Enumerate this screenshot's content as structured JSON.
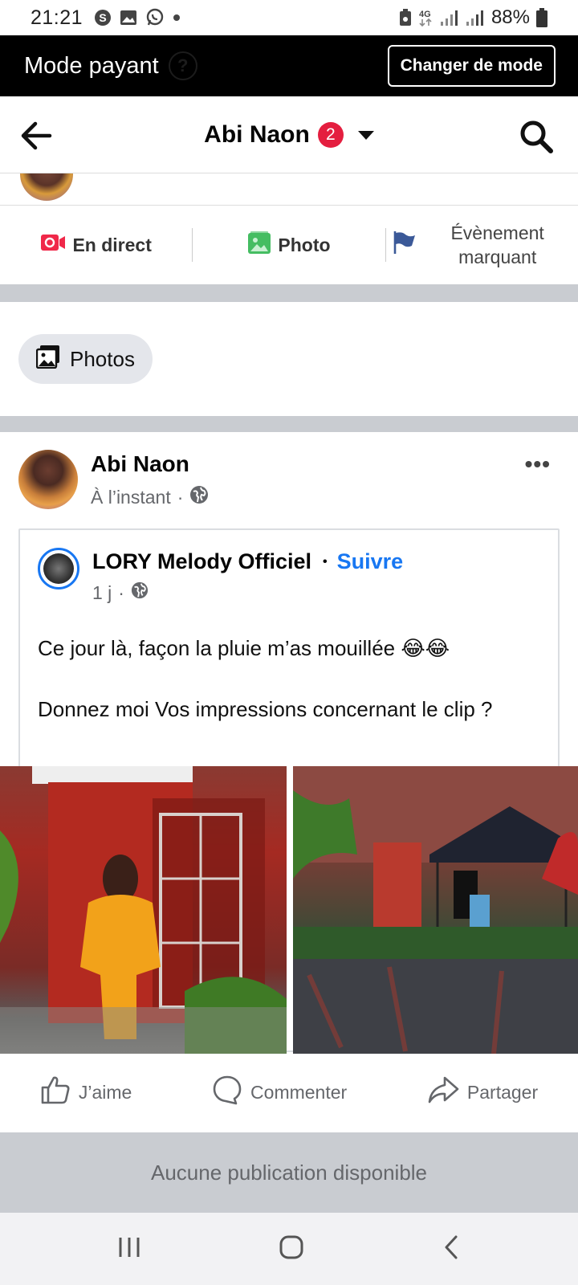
{
  "status_bar": {
    "time": "21:21",
    "network": "4G",
    "battery": "88%",
    "left_icons": [
      "skype-icon",
      "gallery-icon",
      "whatsapp-icon",
      "dot-icon"
    ],
    "right_icons": [
      "data-saver-icon",
      "signal-icon",
      "signal-icon",
      "battery-icon"
    ]
  },
  "mode_bar": {
    "title": "Mode payant",
    "help": "?",
    "button": "Changer de mode"
  },
  "header": {
    "title": "Abi Naon",
    "badge": "2"
  },
  "composer_actions": {
    "live": "En direct",
    "photo": "Photo",
    "event": "Évènement marquant"
  },
  "chips": {
    "photos": "Photos"
  },
  "post": {
    "author": "Abi Naon",
    "time": "À l’instant",
    "more": "•••",
    "shared": {
      "page_name": "LORY Melody Officiel",
      "separator": "•",
      "follow": "Suivre",
      "time": "1 j",
      "text_line1": "Ce jour là, façon la pluie m’as mouillée 😂😂",
      "text_line2": "Donnez moi Vos impressions concernant le clip ?"
    },
    "actions": {
      "like": "J’aime",
      "comment": "Commenter",
      "share": "Partager"
    }
  },
  "empty_state": "Aucune publication disponible",
  "colors": {
    "accent": "#1877f2",
    "badge": "#e41e3f",
    "separator": "#c9ccd1",
    "live_red": "#f02849",
    "photo_green": "#45bd62",
    "flag_blue": "#3b5998"
  }
}
